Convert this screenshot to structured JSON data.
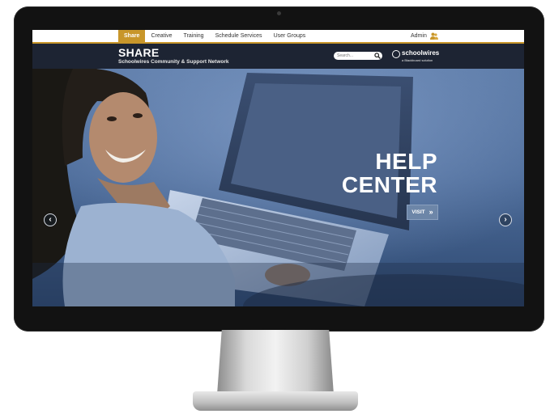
{
  "nav": {
    "items": [
      {
        "label": "Share",
        "active": true
      },
      {
        "label": "Creative",
        "active": false
      },
      {
        "label": "Training",
        "active": false
      },
      {
        "label": "Schedule Services",
        "active": false
      },
      {
        "label": "User Groups",
        "active": false
      }
    ],
    "admin_label": "Admin"
  },
  "header": {
    "title": "SHARE",
    "subtitle": "Schoolwires Community & Support Network",
    "search_placeholder": "Search...",
    "logo_name": "schoolwires",
    "logo_tagline": "a Blackboard solution"
  },
  "hero": {
    "title_line1": "HELP",
    "title_line2": "CENTER",
    "button_label": "VISIT",
    "button_icon": "double-chevron-right-icon",
    "prev_icon": "chevron-left-icon",
    "next_icon": "chevron-right-icon"
  },
  "colors": {
    "accent": "#c8962a",
    "header_bg": "#1d2433",
    "hero_blue": "#4c6b99",
    "bezel": "#121212"
  }
}
